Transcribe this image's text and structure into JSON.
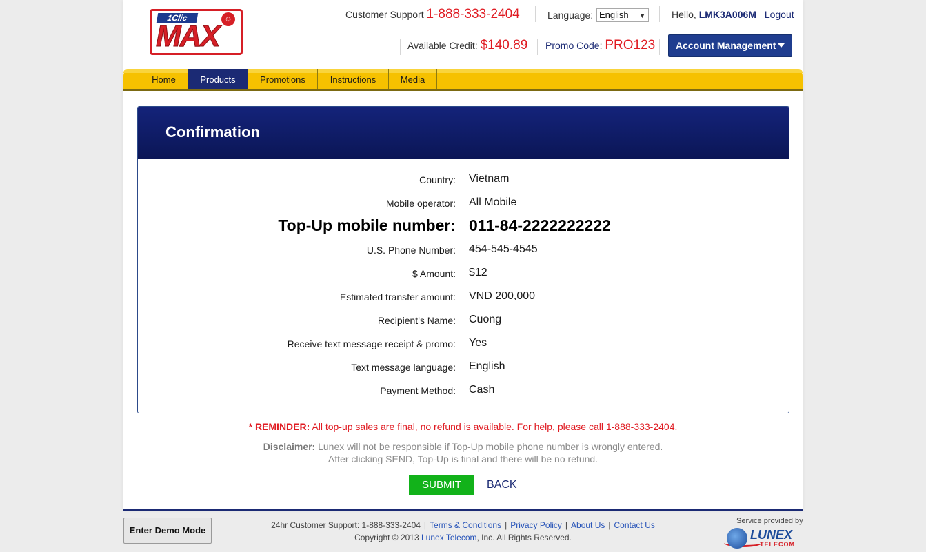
{
  "header": {
    "logo_small": "1Clic",
    "logo_big": "MAX",
    "support_label": "Customer Support",
    "support_phone": "1-888-333-2404",
    "language_label": "Language:",
    "language_value": "English",
    "hello_label": "Hello,",
    "username": "LMK3A006M",
    "logout_label": "Logout",
    "credit_label": "Available Credit:",
    "credit_value": "$140.89",
    "promo_label": "Promo Code",
    "promo_value": "PRO123",
    "account_button": "Account Management"
  },
  "nav": {
    "items": [
      {
        "label": "Home"
      },
      {
        "label": "Products"
      },
      {
        "label": "Promotions"
      },
      {
        "label": "Instructions"
      },
      {
        "label": "Media"
      }
    ],
    "active_index": 1
  },
  "confirmation": {
    "title": "Confirmation",
    "rows": [
      {
        "label": "Country:",
        "value": "Vietnam"
      },
      {
        "label": "Mobile operator:",
        "value": "All Mobile"
      },
      {
        "label": "Top-Up mobile number:",
        "value": "011-84-2222222222"
      },
      {
        "label": "U.S. Phone Number:",
        "value": "454-545-4545"
      },
      {
        "label": "$ Amount:",
        "value": "$12"
      },
      {
        "label": "Estimated transfer amount:",
        "value": "VND 200,000"
      },
      {
        "label": "Recipient's Name:",
        "value": "Cuong"
      },
      {
        "label": "Receive text message receipt & promo:",
        "value": "Yes"
      },
      {
        "label": "Text message language:",
        "value": "English"
      },
      {
        "label": "Payment Method:",
        "value": "Cash"
      }
    ]
  },
  "reminder": {
    "prefix": "* ",
    "label": "REMINDER:",
    "text": " All top-up sales are final, no refund is available. For help, please call 1-888-333-2404."
  },
  "disclaimer": {
    "label": "Disclaimer:",
    "line1": " Lunex will not be responsible if Top-Up mobile phone number is wrongly entered.",
    "line2": "After clicking SEND, Top-Up is final and there will be no refund."
  },
  "actions": {
    "submit_label": "SUBMIT",
    "back_label": "BACK"
  },
  "footer": {
    "demo_button": "Enter Demo Mode",
    "support_text": "24hr Customer Support: 1-888-333-2404",
    "links": [
      "Terms & Conditions",
      "Privacy Policy",
      "About Us",
      "Contact Us"
    ],
    "copyright_prefix": "Copyright © 2013 ",
    "copyright_link": "Lunex Telecom",
    "copyright_suffix": ", Inc. All Rights Reserved.",
    "service_label": "Service provided by",
    "lunex_name": "LUNEX",
    "lunex_sub": "TELECOM"
  }
}
